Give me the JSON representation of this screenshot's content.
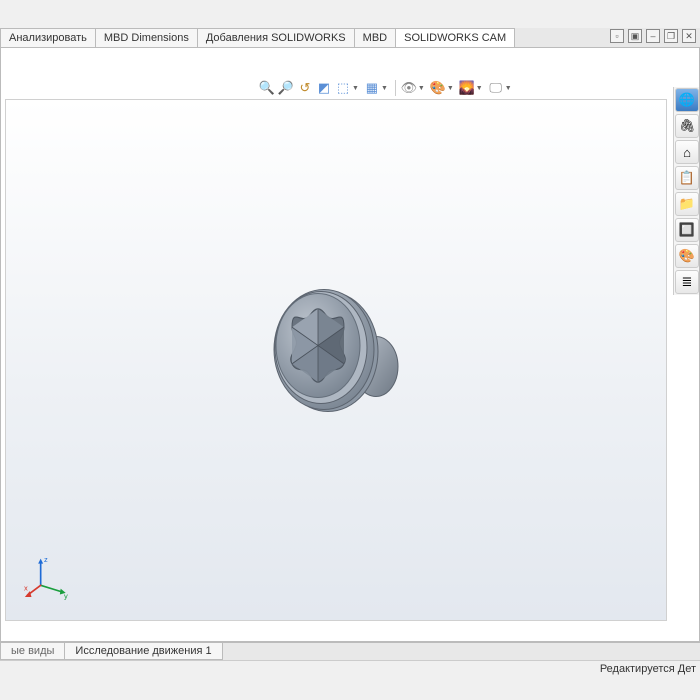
{
  "ribbon": {
    "tabs": [
      {
        "label": "Анализировать"
      },
      {
        "label": "MBD Dimensions"
      },
      {
        "label": "Добавления SOLIDWORKS"
      },
      {
        "label": "MBD"
      },
      {
        "label": "SOLIDWORKS CAM"
      }
    ]
  },
  "view_toolbar": {
    "icons": [
      "zoom-fit",
      "zoom-area",
      "prev-view",
      "section",
      "display-style",
      "hide-show",
      "edit-appearance",
      "apply-scene",
      "view-settings"
    ]
  },
  "right_panel": {
    "buttons": [
      {
        "name": "globe-icon",
        "glyph": "🌐"
      },
      {
        "name": "link-icon",
        "glyph": "🔗"
      },
      {
        "name": "home-icon",
        "glyph": "⌂"
      },
      {
        "name": "bin-icon",
        "glyph": "🗑"
      },
      {
        "name": "folder-icon",
        "glyph": "📁"
      },
      {
        "name": "views-icon",
        "glyph": "🔲"
      },
      {
        "name": "appearance-icon",
        "glyph": "🎨"
      },
      {
        "name": "props-icon",
        "glyph": "≣"
      }
    ]
  },
  "bottom_tabs": {
    "tab1_trunc": "ые виды",
    "tab2": "Исследование движения 1"
  },
  "status": {
    "right": "Редактируется Дет"
  },
  "triad": {
    "axes": [
      "x",
      "y",
      "z"
    ]
  }
}
